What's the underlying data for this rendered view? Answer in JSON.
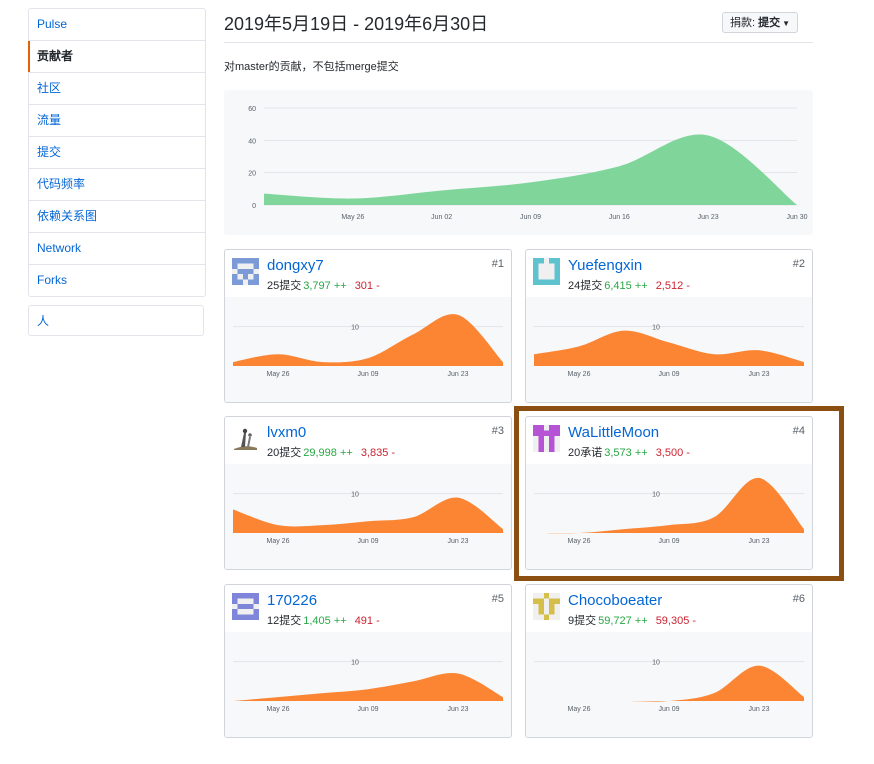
{
  "sidebar": {
    "items": [
      {
        "label": "Pulse",
        "selected": false
      },
      {
        "label": "贡献者",
        "selected": true
      },
      {
        "label": "社区",
        "selected": false
      },
      {
        "label": "流量",
        "selected": false
      },
      {
        "label": "提交",
        "selected": false
      },
      {
        "label": "代码频率",
        "selected": false
      },
      {
        "label": "依赖关系图",
        "selected": false
      },
      {
        "label": "Network",
        "selected": false
      },
      {
        "label": "Forks",
        "selected": false
      }
    ],
    "people_label": "人"
  },
  "header": {
    "date_range": "2019年5月19日 - 2019年6月30日",
    "contrib_prefix": "捐款:",
    "contrib_value": "提交",
    "subtitle": "对master的贡献，不包括merge提交"
  },
  "colors": {
    "main_area": "#7fd59a",
    "card_area": "#fb8532",
    "highlight": "#8b4f12",
    "link": "#0366d6",
    "add": "#28a745",
    "del": "#cb2431"
  },
  "chart_data": {
    "type": "area",
    "x_ticks": [
      "May 26",
      "Jun 02",
      "Jun 09",
      "Jun 16",
      "Jun 23",
      "Jun 30"
    ],
    "y_ticks": [
      "0",
      "20",
      "40",
      "60"
    ],
    "ylim": [
      0,
      60
    ],
    "x": [
      "May 19",
      "May 26",
      "Jun 02",
      "Jun 09",
      "Jun 16",
      "Jun 23",
      "Jun 30"
    ],
    "values": [
      7,
      4,
      9,
      14,
      24,
      43,
      0
    ]
  },
  "contributors": [
    {
      "login": "dongxy7",
      "commits": "25提交",
      "additions": "3,797 ++",
      "deletions": "301 -",
      "rank": "#1",
      "avatar": "identicon-blue-avatar",
      "y_tick": "10",
      "x_ticks": [
        "May 26",
        "Jun 09",
        "Jun 23"
      ],
      "ylim": [
        0,
        15
      ],
      "values": [
        1,
        3,
        1,
        2,
        8,
        13,
        1
      ]
    },
    {
      "login": "Yuefengxin",
      "commits": "24提交",
      "additions": "6,415 ++",
      "deletions": "2,512 -",
      "rank": "#2",
      "avatar": "identicon-teal-avatar",
      "y_tick": "10",
      "x_ticks": [
        "May 26",
        "Jun 09",
        "Jun 23"
      ],
      "ylim": [
        0,
        15
      ],
      "values": [
        3,
        5,
        9,
        6,
        3,
        4,
        1
      ]
    },
    {
      "login": "lvxm0",
      "commits": "20提交",
      "additions": "29,998 ++",
      "deletions": "3,835 -",
      "rank": "#3",
      "avatar": "photo-avatar",
      "y_tick": "10",
      "x_ticks": [
        "May 26",
        "Jun 09",
        "Jun 23"
      ],
      "ylim": [
        0,
        15
      ],
      "values": [
        6,
        2,
        2,
        3,
        4,
        9,
        1
      ]
    },
    {
      "login": "WaLittleMoon",
      "commits": "20承诺",
      "additions": "3,573 ++",
      "deletions": "3,500 -",
      "rank": "#4",
      "avatar": "identicon-purple-avatar",
      "y_tick": "10",
      "x_ticks": [
        "May 26",
        "Jun 09",
        "Jun 23"
      ],
      "ylim": [
        0,
        15
      ],
      "values": [
        0,
        0,
        1,
        2,
        4,
        14,
        1
      ]
    },
    {
      "login": "170226",
      "commits": "12提交",
      "additions": "1,405 ++",
      "deletions": "491 -",
      "rank": "#5",
      "avatar": "identicon-indigo-avatar",
      "y_tick": "10",
      "x_ticks": [
        "May 26",
        "Jun 09",
        "Jun 23"
      ],
      "ylim": [
        0,
        15
      ],
      "values": [
        0,
        1,
        2,
        3,
        5,
        7,
        1
      ]
    },
    {
      "login": "Chocoboeater",
      "commits": "9提交",
      "additions": "59,727 ++",
      "deletions": "59,305 -",
      "rank": "#6",
      "avatar": "identicon-olive-avatar",
      "y_tick": "10",
      "x_ticks": [
        "May 26",
        "Jun 09",
        "Jun 23"
      ],
      "ylim": [
        0,
        15
      ],
      "values": [
        0,
        0,
        0,
        0,
        2,
        9,
        1
      ]
    }
  ]
}
